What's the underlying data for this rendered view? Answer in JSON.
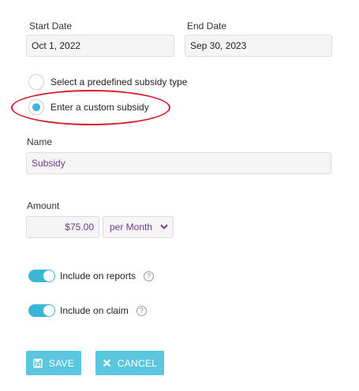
{
  "dates": {
    "start_label": "Start Date",
    "start_value": "Oct 1, 2022",
    "end_label": "End Date",
    "end_value": "Sep 30, 2023"
  },
  "subsidy_type": {
    "options": [
      {
        "label": "Select a predefined subsidy type",
        "checked": false
      },
      {
        "label": "Enter a custom subsidy",
        "checked": true
      }
    ]
  },
  "name": {
    "label": "Name",
    "value": "Subsidy"
  },
  "amount": {
    "label": "Amount",
    "value": "$75.00",
    "period": "per Month"
  },
  "toggles": [
    {
      "label": "Include on reports",
      "on": true,
      "help": "?"
    },
    {
      "label": "Include on claim",
      "on": true,
      "help": "?"
    }
  ],
  "actions": {
    "save_label": "SAVE",
    "cancel_label": "CANCEL"
  },
  "colors": {
    "accent": "#3cb6d7",
    "button": "#5cc6df",
    "value_text": "#6f3b8f",
    "highlight_ellipse": "#d6202f"
  }
}
